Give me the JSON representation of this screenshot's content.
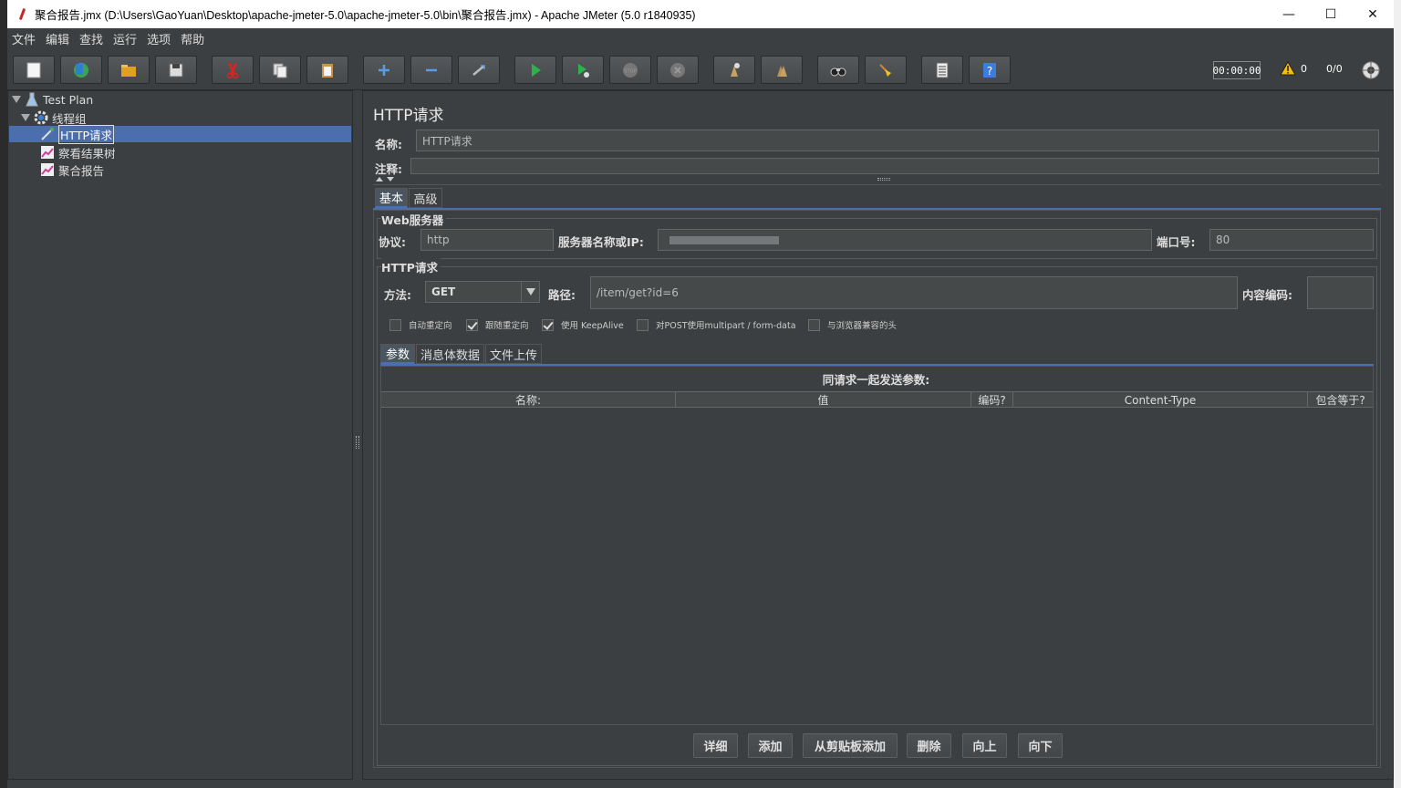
{
  "window": {
    "title": "聚合报告.jmx (D:\\Users\\GaoYuan\\Desktop\\apache-jmeter-5.0\\apache-jmeter-5.0\\bin\\聚合报告.jmx) - Apache JMeter (5.0 r1840935)",
    "minimize": "—",
    "maximize": "☐",
    "close": "✕"
  },
  "menu": [
    "文件",
    "编辑",
    "查找",
    "运行",
    "选项",
    "帮助"
  ],
  "toolbar": {
    "timer": "00:00:00",
    "warning_count": "0",
    "thread_ratio": "0/0"
  },
  "tree": {
    "items": [
      {
        "label": "Test Plan"
      },
      {
        "label": "线程组"
      },
      {
        "label": "HTTP请求"
      },
      {
        "label": "察看结果树"
      },
      {
        "label": "聚合报告"
      }
    ]
  },
  "panel": {
    "title": "HTTP请求",
    "name_label": "名称:",
    "name_value": "HTTP请求",
    "comment_label": "注释:",
    "comment_value": "",
    "tabs": [
      "基本",
      "高级"
    ],
    "web_server": {
      "group_title": "Web服务器",
      "protocol_label": "协议:",
      "protocol_value": "http",
      "server_label": "服务器名称或IP:",
      "server_value": "",
      "port_label": "端口号:",
      "port_value": "80"
    },
    "http_request": {
      "group_title": "HTTP请求",
      "method_label": "方法:",
      "method_value": "GET",
      "path_label": "路径:",
      "path_value": "/item/get?id=6",
      "encoding_label": "内容编码:",
      "encoding_value": ""
    },
    "checkboxes": [
      {
        "label": "自动重定向",
        "checked": false
      },
      {
        "label": "跟随重定向",
        "checked": true
      },
      {
        "label": "使用 KeepAlive",
        "checked": true
      },
      {
        "label": "对POST使用multipart / form-data",
        "checked": false
      },
      {
        "label": "与浏览器兼容的头",
        "checked": false
      }
    ],
    "subtabs": [
      "参数",
      "消息体数据",
      "文件上传"
    ],
    "params_title": "同请求一起发送参数:",
    "columns": [
      "名称:",
      "值",
      "编码?",
      "Content-Type",
      "包含等于?"
    ],
    "buttons": [
      "详细",
      "添加",
      "从剪贴板添加",
      "删除",
      "向上",
      "向下"
    ]
  }
}
